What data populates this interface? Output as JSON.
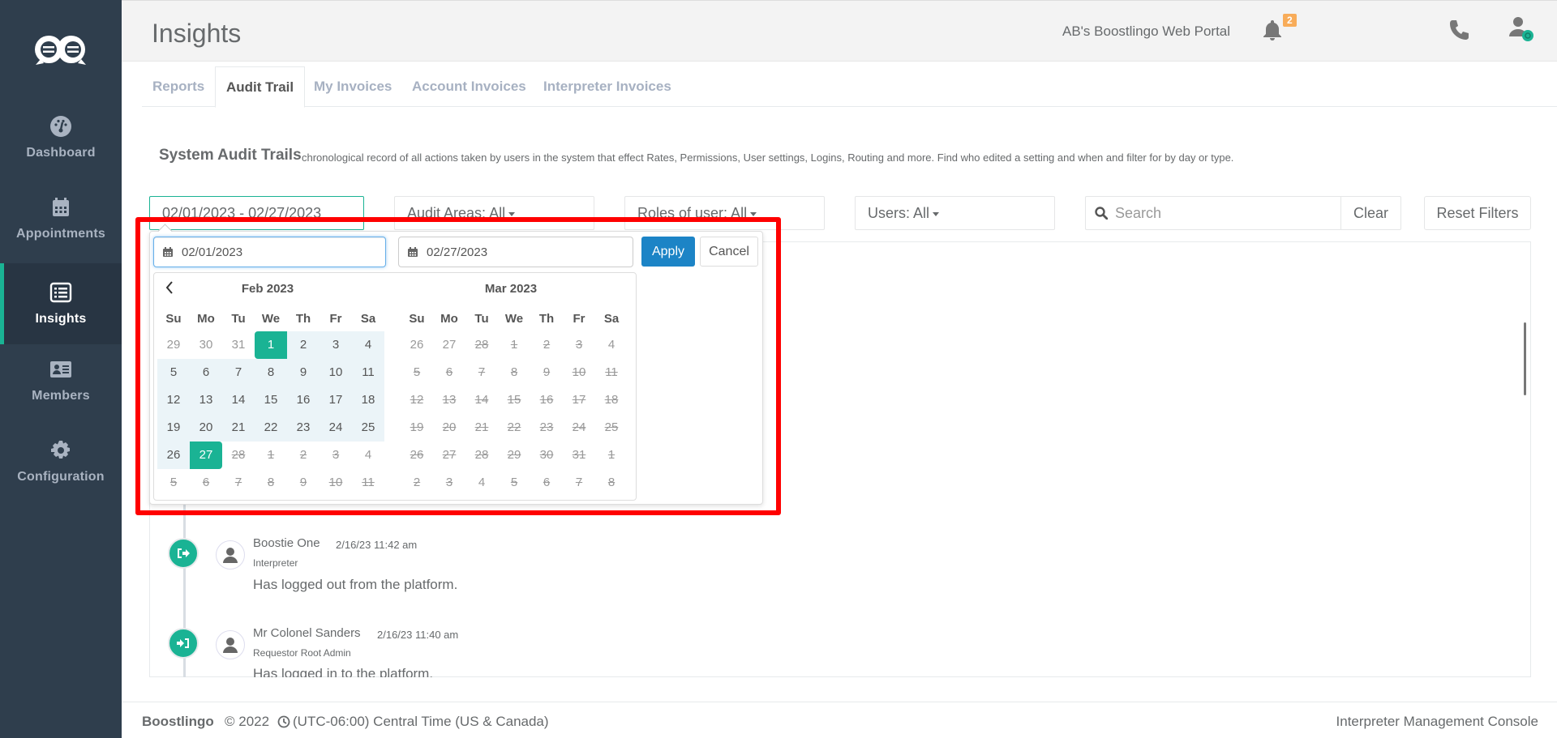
{
  "sidebar": {
    "items": [
      {
        "label": "Dashboard",
        "icon": "dashboard-icon"
      },
      {
        "label": "Appointments",
        "icon": "calendar-icon"
      },
      {
        "label": "Insights",
        "icon": "list-icon",
        "active": true
      },
      {
        "label": "Members",
        "icon": "id-card-icon"
      },
      {
        "label": "Configuration",
        "icon": "gear-icon"
      }
    ]
  },
  "header": {
    "title": "Insights",
    "portal_name": "AB's Boostlingo Web Portal",
    "notification_count": "2"
  },
  "tabs": [
    {
      "label": "Reports"
    },
    {
      "label": "Audit Trail",
      "active": true
    },
    {
      "label": "My Invoices"
    },
    {
      "label": "Account Invoices"
    },
    {
      "label": "Interpreter Invoices"
    }
  ],
  "section": {
    "title": "System Audit Trails",
    "description": "chronological record of all actions taken by users in the system that effect Rates, Permissions, User settings, Logins, Routing and more. Find who edited a setting and when and filter for by day or type."
  },
  "filters": {
    "date_range": "02/01/2023 - 02/27/2023",
    "audit_areas": "Audit Areas: All",
    "roles": "Roles of user: All",
    "users": "Users: All",
    "search_placeholder": "Search",
    "search_value": "",
    "clear_label": "Clear",
    "reset_label": "Reset Filters"
  },
  "datepicker": {
    "start_date": "02/01/2023",
    "end_date": "02/27/2023",
    "apply_label": "Apply",
    "cancel_label": "Cancel",
    "weekdays": [
      "Su",
      "Mo",
      "Tu",
      "We",
      "Th",
      "Fr",
      "Sa"
    ],
    "left_month": {
      "title": "Feb 2023",
      "days": [
        {
          "d": "29",
          "s": "off"
        },
        {
          "d": "30",
          "s": "off"
        },
        {
          "d": "31",
          "s": "off"
        },
        {
          "d": "1",
          "s": "start"
        },
        {
          "d": "2",
          "s": "inrange"
        },
        {
          "d": "3",
          "s": "inrange"
        },
        {
          "d": "4",
          "s": "inrange"
        },
        {
          "d": "5",
          "s": "inrange"
        },
        {
          "d": "6",
          "s": "inrange"
        },
        {
          "d": "7",
          "s": "inrange"
        },
        {
          "d": "8",
          "s": "inrange"
        },
        {
          "d": "9",
          "s": "inrange"
        },
        {
          "d": "10",
          "s": "inrange"
        },
        {
          "d": "11",
          "s": "inrange"
        },
        {
          "d": "12",
          "s": "inrange"
        },
        {
          "d": "13",
          "s": "inrange"
        },
        {
          "d": "14",
          "s": "inrange"
        },
        {
          "d": "15",
          "s": "inrange"
        },
        {
          "d": "16",
          "s": "inrange"
        },
        {
          "d": "17",
          "s": "inrange"
        },
        {
          "d": "18",
          "s": "inrange"
        },
        {
          "d": "19",
          "s": "inrange"
        },
        {
          "d": "20",
          "s": "inrange"
        },
        {
          "d": "21",
          "s": "inrange"
        },
        {
          "d": "22",
          "s": "inrange"
        },
        {
          "d": "23",
          "s": "inrange"
        },
        {
          "d": "24",
          "s": "inrange"
        },
        {
          "d": "25",
          "s": "inrange"
        },
        {
          "d": "26",
          "s": "inrange"
        },
        {
          "d": "27",
          "s": "end"
        },
        {
          "d": "28",
          "s": "dis"
        },
        {
          "d": "1",
          "s": "dis"
        },
        {
          "d": "2",
          "s": "dis"
        },
        {
          "d": "3",
          "s": "dis"
        },
        {
          "d": "4",
          "s": "off"
        },
        {
          "d": "5",
          "s": "dis"
        },
        {
          "d": "6",
          "s": "dis"
        },
        {
          "d": "7",
          "s": "dis"
        },
        {
          "d": "8",
          "s": "dis"
        },
        {
          "d": "9",
          "s": "dis"
        },
        {
          "d": "10",
          "s": "dis"
        },
        {
          "d": "11",
          "s": "dis"
        }
      ]
    },
    "right_month": {
      "title": "Mar 2023",
      "days": [
        {
          "d": "26",
          "s": "off"
        },
        {
          "d": "27",
          "s": "off"
        },
        {
          "d": "28",
          "s": "dis"
        },
        {
          "d": "1",
          "s": "dis"
        },
        {
          "d": "2",
          "s": "dis"
        },
        {
          "d": "3",
          "s": "dis"
        },
        {
          "d": "4",
          "s": "off"
        },
        {
          "d": "5",
          "s": "dis"
        },
        {
          "d": "6",
          "s": "dis"
        },
        {
          "d": "7",
          "s": "dis"
        },
        {
          "d": "8",
          "s": "dis"
        },
        {
          "d": "9",
          "s": "dis"
        },
        {
          "d": "10",
          "s": "dis"
        },
        {
          "d": "11",
          "s": "dis"
        },
        {
          "d": "12",
          "s": "dis"
        },
        {
          "d": "13",
          "s": "dis"
        },
        {
          "d": "14",
          "s": "dis"
        },
        {
          "d": "15",
          "s": "dis"
        },
        {
          "d": "16",
          "s": "dis"
        },
        {
          "d": "17",
          "s": "dis"
        },
        {
          "d": "18",
          "s": "dis"
        },
        {
          "d": "19",
          "s": "dis"
        },
        {
          "d": "20",
          "s": "dis"
        },
        {
          "d": "21",
          "s": "dis"
        },
        {
          "d": "22",
          "s": "dis"
        },
        {
          "d": "23",
          "s": "dis"
        },
        {
          "d": "24",
          "s": "dis"
        },
        {
          "d": "25",
          "s": "dis"
        },
        {
          "d": "26",
          "s": "dis"
        },
        {
          "d": "27",
          "s": "dis"
        },
        {
          "d": "28",
          "s": "dis"
        },
        {
          "d": "29",
          "s": "dis"
        },
        {
          "d": "30",
          "s": "dis"
        },
        {
          "d": "31",
          "s": "dis"
        },
        {
          "d": "1",
          "s": "dis"
        },
        {
          "d": "2",
          "s": "dis"
        },
        {
          "d": "3",
          "s": "dis"
        },
        {
          "d": "4",
          "s": "off"
        },
        {
          "d": "5",
          "s": "dis"
        },
        {
          "d": "6",
          "s": "dis"
        },
        {
          "d": "7",
          "s": "dis"
        },
        {
          "d": "8",
          "s": "dis"
        }
      ]
    }
  },
  "entries": [
    {
      "name": "Boostie One",
      "time": "2/16/23 11:42 am",
      "role": "Interpreter",
      "message": "Has logged out from the platform.",
      "icon": "logout-icon"
    },
    {
      "name": "Mr Colonel Sanders",
      "time": "2/16/23 11:40 am",
      "role": "Requestor Root Admin",
      "message": "Has logged in to the platform.",
      "icon": "login-icon"
    }
  ],
  "footer": {
    "brand": "Boostlingo",
    "copyright": "© 2022",
    "timezone": "(UTC-06:00) Central Time (US & Canada)",
    "console": "Interpreter Management Console"
  },
  "colors": {
    "sidebar_bg": "#2f3e4d",
    "accent": "#1ab394",
    "primary_button": "#1c84c6",
    "badge": "#f8ac59",
    "highlight_box": "#ff0000"
  }
}
